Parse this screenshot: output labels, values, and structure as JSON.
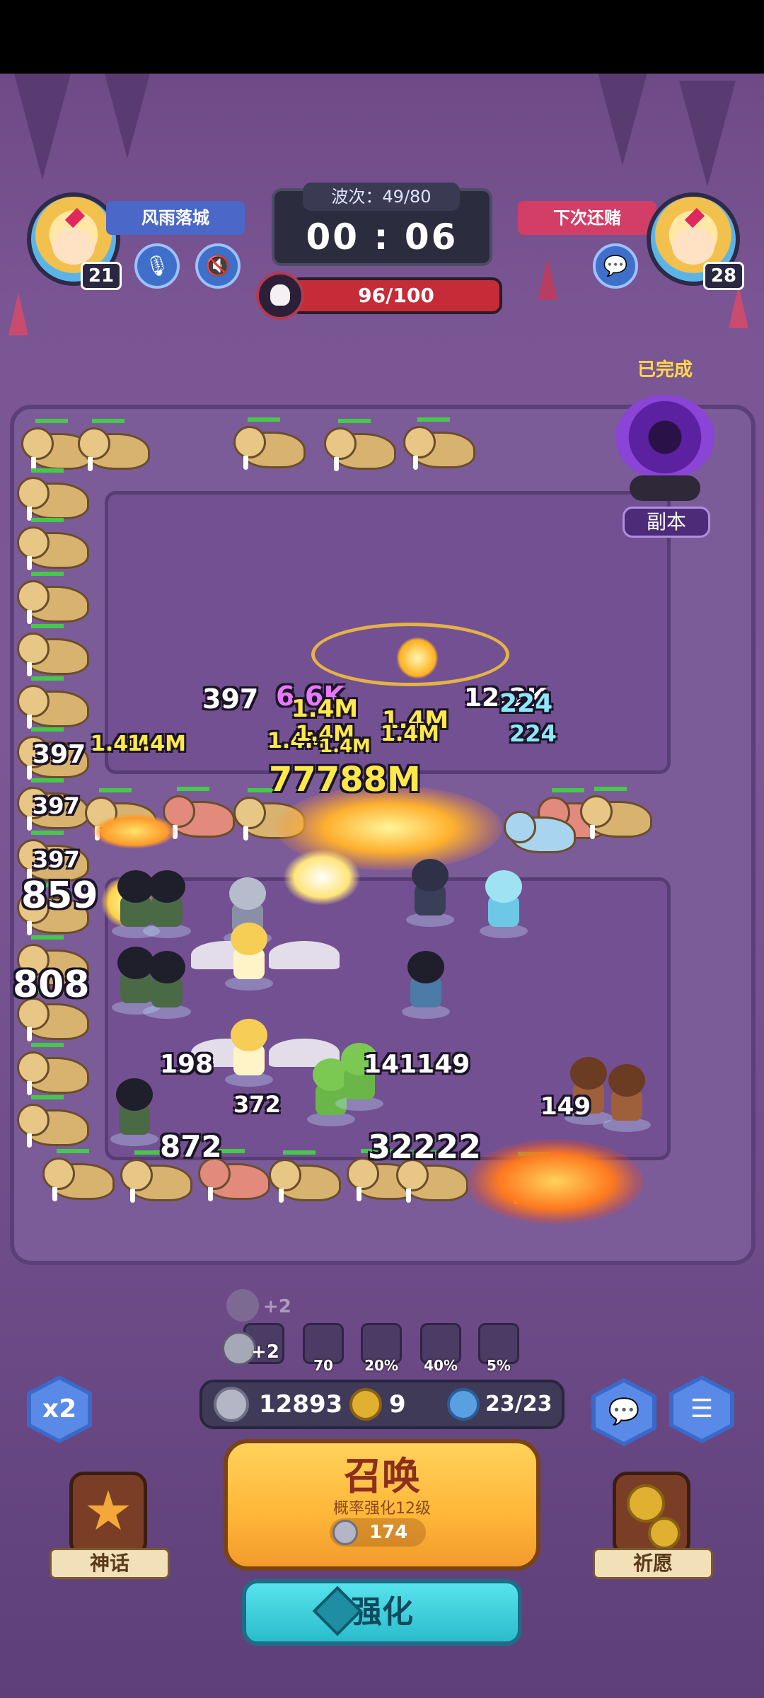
{
  "players": {
    "left": {
      "name": "风雨落城",
      "level": "21"
    },
    "right": {
      "name": "下次还赌",
      "level": "28"
    }
  },
  "hud": {
    "wave_label": "波次：49/80",
    "timer": "00 : 06",
    "boss_hp": "96/100"
  },
  "portal": {
    "status": "已完成",
    "label": "副本"
  },
  "damage_numbers": [
    "397",
    "6.6K",
    "1.4M",
    "1.4M",
    "1.4M",
    "1.4M",
    "1.4M",
    "1.4M",
    "12.2K",
    "224",
    "224",
    "397",
    "1.4M",
    "1.4M",
    "397",
    "397",
    "77788M",
    "859",
    "808",
    "198",
    "372",
    "872",
    "141149",
    "149",
    "32222",
    "+2"
  ],
  "stats": [
    {
      "icon": "attack-up-icon",
      "value": "+2"
    },
    {
      "icon": "critical-icon",
      "value": "70"
    },
    {
      "icon": "power-fist-icon",
      "value": "20%"
    },
    {
      "icon": "speed-icon",
      "value": "40%"
    },
    {
      "icon": "cooldown-icon",
      "value": "5%"
    }
  ],
  "resources": {
    "silver": "12893",
    "clover": "9",
    "units": "23/23"
  },
  "buttons": {
    "speed": "x2",
    "summon_title": "召唤",
    "summon_sub": "概率强化12级",
    "summon_cost": "174",
    "upgrade": "强化",
    "myth": "神话",
    "wish": "祈愿"
  },
  "colors": {
    "summon": "#ffbf3f",
    "upgrade": "#3cc9d8",
    "track": "#7c5b99",
    "boss_bar": "#c62b38"
  }
}
